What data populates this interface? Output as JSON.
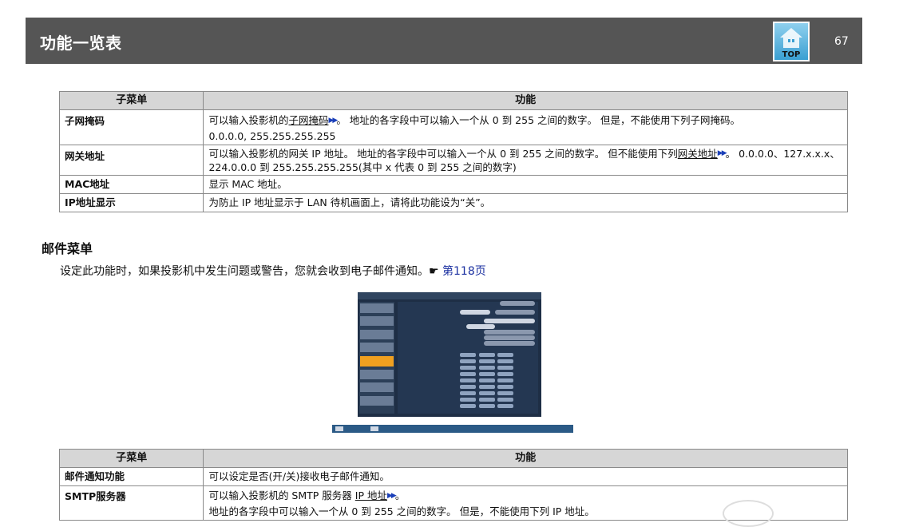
{
  "header": {
    "title": "功能一览表",
    "page_number": "67",
    "top_label": "TOP"
  },
  "table1": {
    "col_sub": "子菜单",
    "col_func": "功能",
    "rows": [
      {
        "k": "子网掩码",
        "v1": "可以输入投影机的",
        "link": "子网掩码",
        "v2": "。 地址的各字段中可以输入一个从 0 到 255 之间的数字。 但是，不能使用下列子网掩码。",
        "line2": "0.0.0.0, 255.255.255.255"
      },
      {
        "k": "网关地址",
        "v1": "可以输入投影机的网关 IP 地址。 地址的各字段中可以输入一个从 0 到 255 之间的数字。 但不能使用下列",
        "link": "网关地址",
        "v2": "。 0.0.0.0、127.x.x.x、",
        "line2": "224.0.0.0 到 255.255.255.255(其中 x 代表 0 到 255 之间的数字)"
      },
      {
        "k": "MAC地址",
        "v": "显示 MAC 地址。"
      },
      {
        "k": "IP地址显示",
        "v": "为防止 IP 地址显示于 LAN 待机画面上，请将此功能设为“关”。"
      }
    ]
  },
  "mail": {
    "title": "邮件菜单",
    "desc": "设定此功能时，如果投影机中发生问题或警告，您就会收到电子邮件通知。",
    "ref_link": "第118页"
  },
  "table2": {
    "col_sub": "子菜单",
    "col_func": "功能",
    "rows": [
      {
        "k": "邮件通知功能",
        "v": "可以设定是否(开/关)接收电子邮件通知。"
      },
      {
        "k": "SMTP服务器",
        "v1": "可以输入投影机的 SMTP 服务器 ",
        "link": "IP 地址",
        "v2": "。",
        "line2": "地址的各字段中可以输入一个从 0 到 255 之间的数字。 但是，不能使用下列 IP 地址。"
      }
    ]
  }
}
